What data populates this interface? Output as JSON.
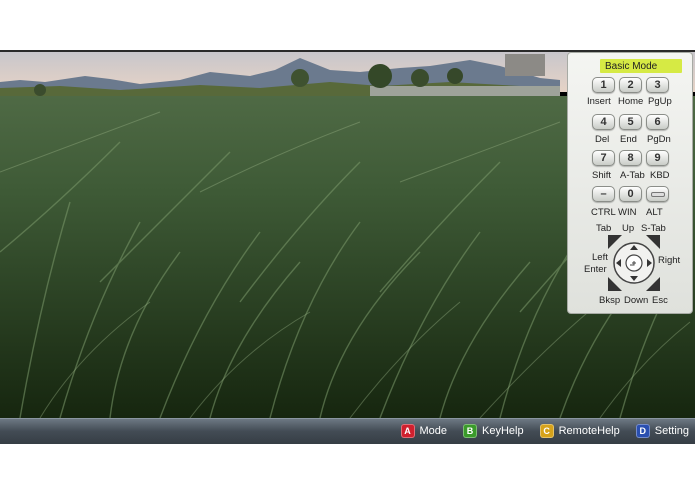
{
  "panel": {
    "mode_title": "Basic Mode",
    "rows": [
      {
        "keys": [
          "1",
          "2",
          "3"
        ],
        "labels": [
          "Insert",
          "Home",
          "PgUp"
        ]
      },
      {
        "keys": [
          "4",
          "5",
          "6"
        ],
        "labels": [
          "Del",
          "End",
          "PgDn"
        ]
      },
      {
        "keys": [
          "7",
          "8",
          "9"
        ],
        "labels": [
          "Shift",
          "A-Tab",
          "KBD"
        ]
      },
      {
        "keys": [
          "–",
          "0",
          ""
        ],
        "labels": [
          "CTRL",
          "WIN",
          "ALT"
        ]
      }
    ],
    "nav": {
      "tab": "Tab",
      "up": "Up",
      "stab": "S-Tab",
      "left": "Left",
      "enter": "Enter",
      "right": "Right",
      "bksp": "Bksp",
      "down": "Down",
      "esc": "Esc"
    }
  },
  "statusbar": {
    "items": [
      {
        "key": "A",
        "label": "Mode",
        "color": "#d0202e"
      },
      {
        "key": "B",
        "label": "KeyHelp",
        "color": "#3a9a2a"
      },
      {
        "key": "C",
        "label": "RemoteHelp",
        "color": "#d6a21a"
      },
      {
        "key": "D",
        "label": "Setting",
        "color": "#2a4fb0"
      }
    ]
  }
}
